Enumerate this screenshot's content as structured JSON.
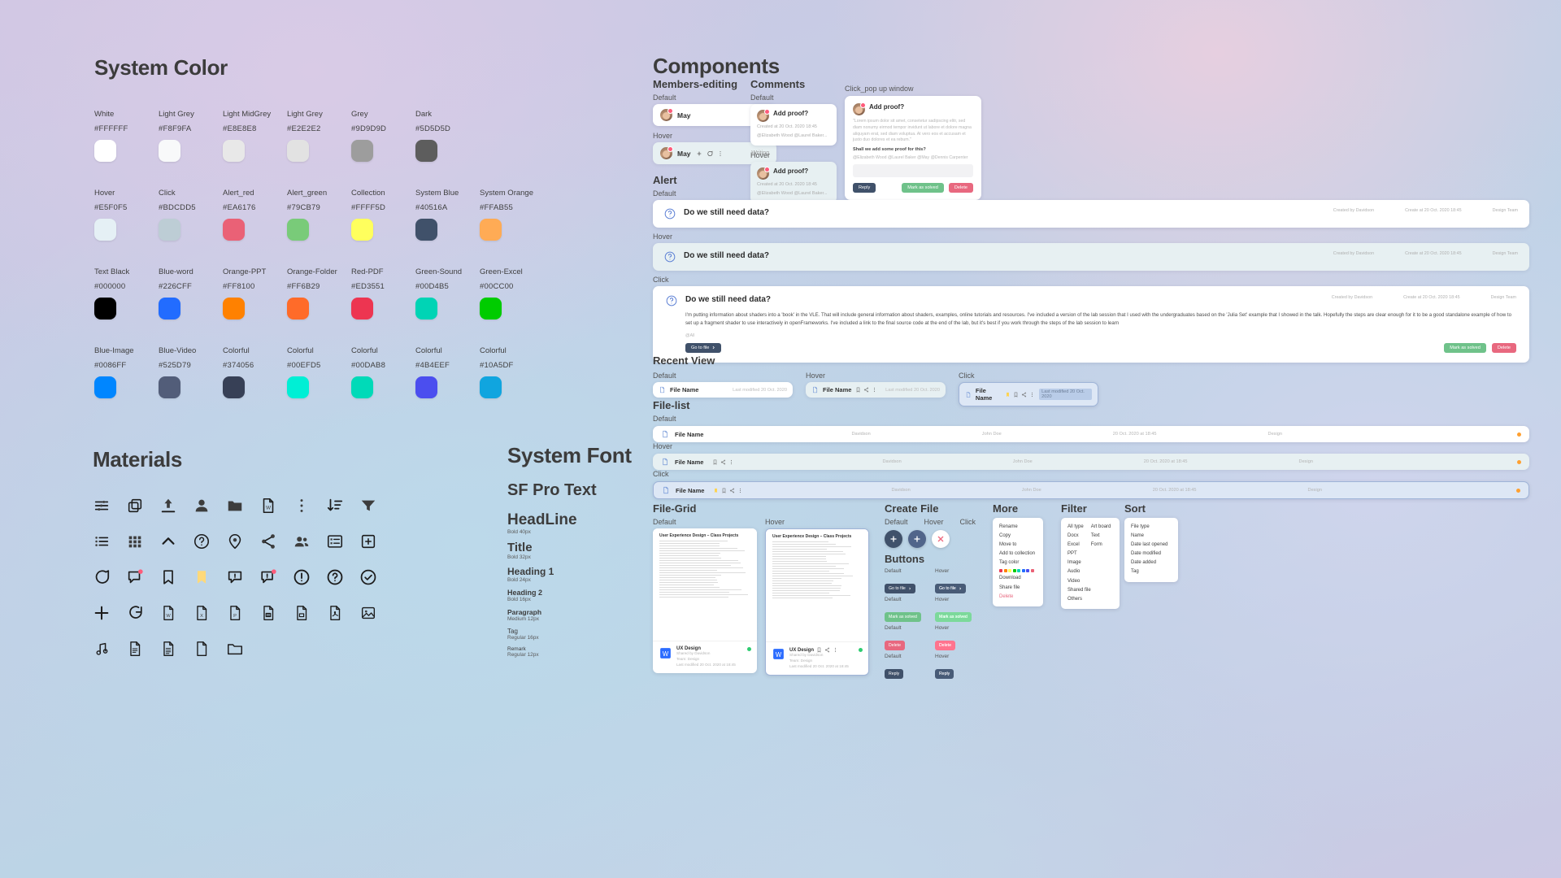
{
  "sections": {
    "system_color": "System Color",
    "materials": "Materials",
    "system_font": "System Font",
    "components": "Components"
  },
  "swatches": [
    {
      "name": "White",
      "hex": "#FFFFFF"
    },
    {
      "name": "Light Grey",
      "hex": "#F8F9FA"
    },
    {
      "name": "Light MidGrey",
      "hex": "#E8E8E8"
    },
    {
      "name": "Light Grey",
      "hex": "#E2E2E2"
    },
    {
      "name": "Grey",
      "hex": "#9D9D9D"
    },
    {
      "name": "Dark",
      "hex": "#5D5D5D"
    },
    {
      "name": "",
      "hex": ""
    },
    {
      "name": "Hover",
      "hex": "#E5F0F5"
    },
    {
      "name": "Click",
      "hex": "#BDCDD5"
    },
    {
      "name": "Alert_red",
      "hex": "#EA6176"
    },
    {
      "name": "Alert_green",
      "hex": "#79CB79"
    },
    {
      "name": "Collection",
      "hex": "#FFFF5D"
    },
    {
      "name": "System Blue",
      "hex": "#40516A"
    },
    {
      "name": "System Orange",
      "hex": "#FFAB55"
    },
    {
      "name": "Text Black",
      "hex": "#000000"
    },
    {
      "name": "Blue-word",
      "hex": "#226CFF"
    },
    {
      "name": "Orange-PPT",
      "hex": "#FF8100"
    },
    {
      "name": "Orange-Folder",
      "hex": "#FF6B29"
    },
    {
      "name": "Red-PDF",
      "hex": "#ED3551"
    },
    {
      "name": "Green-Sound",
      "hex": "#00D4B5"
    },
    {
      "name": "Green-Excel",
      "hex": "#00CC00"
    },
    {
      "name": "Blue-Image",
      "hex": "#0086FF"
    },
    {
      "name": "Blue-Video",
      "hex": "#525D79"
    },
    {
      "name": "Colorful",
      "hex": "#374056"
    },
    {
      "name": "Colorful",
      "hex": "#00EFD5"
    },
    {
      "name": "Colorful",
      "hex": "#00DAB8"
    },
    {
      "name": "Colorful",
      "hex": "#4B4EEF"
    },
    {
      "name": "Colorful",
      "hex": "#10A5DF"
    }
  ],
  "icons": [
    "tune-icon",
    "copy-icon",
    "upload-icon",
    "person-icon",
    "folder-icon",
    "word-file-icon",
    "more-vertical-icon",
    "sort-icon",
    "filter-icon",
    "list-icon",
    "grid-icon",
    "chevron-up-icon",
    "help-circle-icon",
    "location-icon",
    "share-icon",
    "people-icon",
    "list-detail-icon",
    "add-box-icon",
    "comment-icon",
    "comment-dot-icon",
    "bookmark-icon",
    "bookmark-filled-icon",
    "feedback-icon",
    "feedback-dot-icon",
    "error-icon",
    "question-icon",
    "check-circle-icon",
    "plus-icon",
    "chat-icon",
    "word-doc-icon",
    "excel-doc-icon",
    "ppt-doc-icon",
    "text-doc-icon",
    "blank-doc-icon",
    "pdf-doc-icon",
    "image-doc-icon",
    "audio-doc-icon",
    "page-doc-icon",
    "lines-doc-icon",
    "file-doc-icon",
    "folder-outline-icon"
  ],
  "typography": {
    "family": "SF Pro Text",
    "scale": [
      {
        "label": "HeadLine",
        "spec": "Bold 40px"
      },
      {
        "label": "Title",
        "spec": "Bold 32px"
      },
      {
        "label": "Heading 1",
        "spec": "Bold 24px"
      },
      {
        "label": "Heading 2",
        "spec": "Bold 16px"
      },
      {
        "label": "Paragraph",
        "spec": "Medium 12px"
      },
      {
        "label": "Tag",
        "spec": "Regular 16px"
      },
      {
        "label": "Remark",
        "spec": "Regular 12px"
      }
    ]
  },
  "members": {
    "title": "Members-editing",
    "default_label": "Default",
    "hover_label": "Hover",
    "name": "May",
    "state": "Writing"
  },
  "comments": {
    "title": "Comments",
    "default_label": "Default",
    "hover_label": "Hover",
    "heading": "Add proof?",
    "meta": "Created at 20 Oct. 2020 18:45",
    "mentions": "@Elizabeth Wood @Laurel Baker..."
  },
  "popup": {
    "label": "Click_pop up window",
    "heading": "Add proof?",
    "quote": "\"Lorem ipsum dolor sit amet, consetetur sadipscing elitr, sed diam nonumy eirmod tempor invidunt ut labore et dolore magna aliquyam erat, sed diam voluptua. At vero eos et accusam et justo duo dolores et ea rebum.\"",
    "question": "Shall we add some proof for this?",
    "mentions": "@Elizabeth Wood @Laurel Baker @May @Dennis Carpenter",
    "reply": "Reply",
    "solve": "Mark as solved",
    "delete": "Delete"
  },
  "alert": {
    "title": "Alert",
    "states": [
      "Default",
      "Hover",
      "Click"
    ],
    "heading": "Do we still need data?",
    "created_by": "Created by Davidson",
    "created_at": "Create at 20 Oct. 2020 18:45",
    "team": "Design Team",
    "body": "I'm putting information about shaders into a 'book' in the VLE. That will include general information about shaders, examples, online tutorials and resources. I've included a version of the lab session that I used with the undergraduates based on the 'Julia Set' example that I showed in the talk. Hopefully the steps are clear enough for it to be a good standalone example of how to set up a fragment shader to use interactively in openFrameworks. I've included a link to the final source code at the end of the lab, but it's best if you work through the steps of the lab session to learn",
    "at_all": "@All",
    "goto": "Go to file",
    "solve": "Mark as solved",
    "delete": "Delete"
  },
  "recent": {
    "title": "Recent View",
    "states": [
      "Default",
      "Hover",
      "Click"
    ],
    "file_name": "File Name",
    "modified": "Last modified 20 Oct. 2020"
  },
  "filelist": {
    "title": "File-list",
    "states": [
      "Default",
      "Hover",
      "Click"
    ],
    "file_name": "File Name",
    "owner": "Davidson",
    "shared": "John Doe",
    "date": "20 Oct. 2020 at 18:45",
    "tag": "Design"
  },
  "filegrid": {
    "title": "File-Grid",
    "states": [
      "Default",
      "Hover"
    ],
    "doc_title": "User Experience Design – Class Projects",
    "name": "UX Design",
    "shared_by": "Shared by Davidson",
    "team": "Team: Design",
    "modified": "Last modified 20 Oct. 2020 at 18:45"
  },
  "create_file": {
    "title": "Create File",
    "states": [
      "Default",
      "Hover",
      "Click"
    ]
  },
  "buttons": {
    "title": "Buttons",
    "rows": [
      {
        "default_label": "Default",
        "hover_label": "Hover",
        "text": "Go to file",
        "style": "dark"
      },
      {
        "default_label": "Default",
        "hover_label": "Hover",
        "text": "Mark as solved",
        "style": "green"
      },
      {
        "default_label": "Default",
        "hover_label": "Hover",
        "text": "Delete",
        "style": "red"
      },
      {
        "default_label": "Default",
        "hover_label": "Hover",
        "text": "Reply",
        "style": "dark"
      }
    ]
  },
  "more_menu": {
    "title": "More",
    "items": [
      "Rename",
      "Copy",
      "Move to",
      "Add to collection",
      "Tag color",
      "",
      "Download",
      "Share file",
      "Delete"
    ]
  },
  "filter_menu": {
    "title": "Filter",
    "left": [
      "All type",
      "Docx",
      "Excel",
      "PPT",
      "Image",
      "Audio",
      "Video",
      "Shared file",
      "Others"
    ],
    "right": [
      "Art board",
      "Text",
      "Form"
    ]
  },
  "sort_menu": {
    "title": "Sort",
    "items": [
      "File type",
      "Name",
      "Date last opened",
      "Date modified",
      "Date added",
      "Tag"
    ]
  },
  "tag_colors": [
    "#ED3551",
    "#FF8100",
    "#FFFF5D",
    "#00CC00",
    "#00D4B5",
    "#226CFF",
    "#4B4EEF",
    "#EA6176"
  ]
}
